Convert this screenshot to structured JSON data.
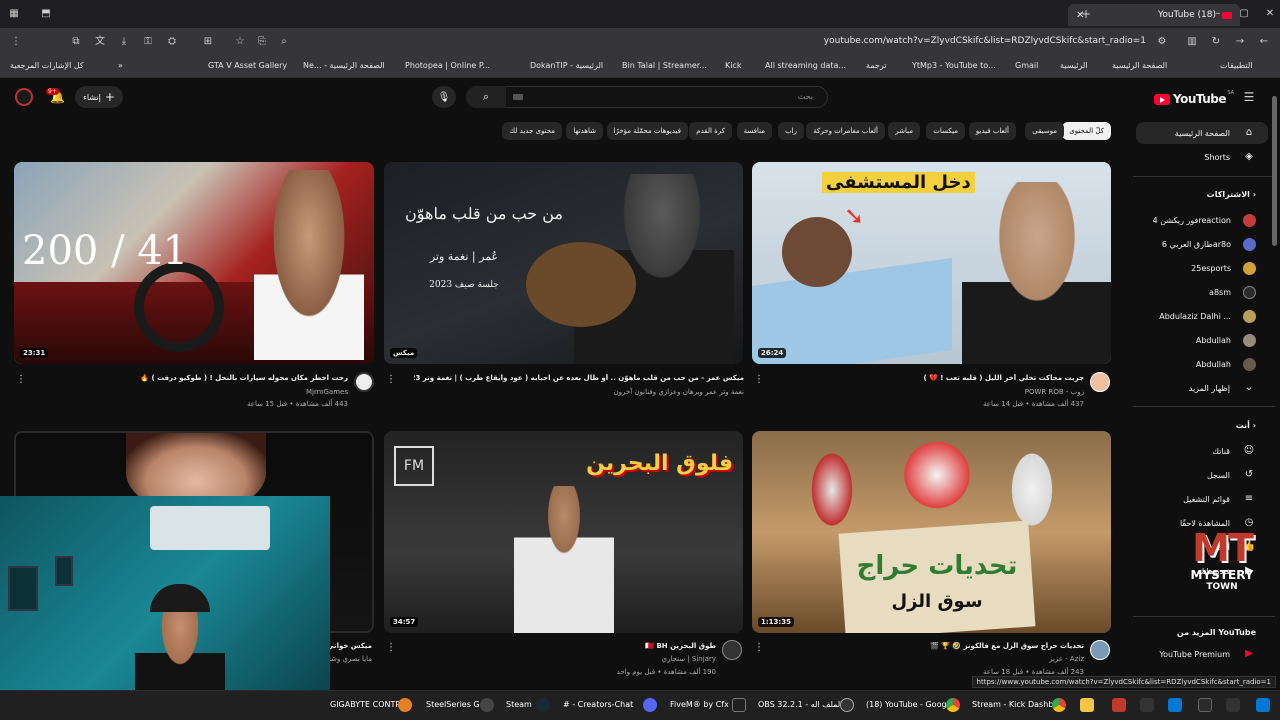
{
  "browser": {
    "tab_title": "(18) YouTube",
    "url": "youtube.com/watch?v=ZlyvdCSkifc&list=RDZlyvdCSkifc&start_radio=1",
    "bookmarks": [
      "كل الإشارات المرجعية",
      "GTA V Asset Gallery",
      "Ne... - الصفحة الرئيسية",
      "Photopea | Online P...",
      "DokanTIP - الرئيسية",
      "Bin Talal | Streamer...",
      "Kick",
      "All streaming data...",
      "ترجمة",
      "YtMp3 - YouTube to...",
      "Gmail",
      "الرئيسية",
      "الصفحة الرئيسية",
      "التطبيقات"
    ],
    "status_url": "https://www.youtube.com/watch?v=ZlyvdCSkifc&list=RDZlyvdCSkifc&start_radio=1"
  },
  "header": {
    "logo": "YouTube",
    "logo_cc": "SA",
    "search_placeholder": "بحث",
    "create_label": "إنشاء",
    "notif_count": "9+"
  },
  "chips": [
    "كلّ المحتوى",
    "موسيقى",
    "ألعاب فيديو",
    "ميكسات",
    "مباشر",
    "ألعاب مغامرات وحركة",
    "راب",
    "منافسة",
    "كرة القدم",
    "فيديوهات محمّلة مؤخرًا",
    "شاهدتها",
    "محتوى جديد لك"
  ],
  "sidebar": {
    "main": [
      {
        "label": "الصفحة الرئيسية",
        "icon": "home-icon"
      },
      {
        "label": "Shorts",
        "icon": "shorts-icon"
      }
    ],
    "subs_header": "الاشتراكات",
    "subs": [
      {
        "label": "فور ريكشن 4reaction",
        "color": "#c63b3b"
      },
      {
        "label": "طارق العربي 6ar8o",
        "color": "#5a6acd"
      },
      {
        "label": "25esports",
        "color": "#d1a23a"
      },
      {
        "label": "a8sm",
        "color": "#2c2c2c"
      },
      {
        "label": "Abdulaziz Dalhi ...",
        "color": "#b8a05a"
      },
      {
        "label": "Abdullah",
        "color": "#9a8a7a"
      },
      {
        "label": "Abdullah",
        "color": "#6a5a4a"
      }
    ],
    "show_more": "إظهار المزيد",
    "you_header": "أنت",
    "you": [
      {
        "label": "قناتك",
        "icon": "account-icon"
      },
      {
        "label": "السجل",
        "icon": "history-icon"
      },
      {
        "label": "قوائم التشغيل",
        "icon": "playlists-icon"
      },
      {
        "label": "المشاهدة لاحقًا",
        "icon": "watch-later-icon"
      },
      {
        "label": "أعجبني",
        "icon": "like-icon"
      },
      {
        "label": "فيديوهاتك",
        "icon": "your-videos-icon"
      }
    ],
    "more_header": "المزيد من YouTube",
    "premium": "YouTube Premium"
  },
  "videos": [
    {
      "title": "رحت اخطر مكان محوله سيارات بالنحل ! ( طوكيو درفت ) 🔥",
      "channel": "MjrmGames",
      "meta": "443 ألف مشاهدة • قبل 15 ساعة",
      "duration": "23:31",
      "overlay": "200 / 41"
    },
    {
      "title": "ميكس عمر - من حب من قلب ماهوّن .. أو طال بعده عن احبابه ( عود وايقاع طرب ) | نغمة وتر 2023",
      "channel": "نغمة وتر عمر وبرهان وعزازي وفنانون آخرون",
      "meta": "",
      "duration": "ميكس",
      "overlay_line1": "من حب من قلب ماهوّن",
      "overlay_line2": "عُمر | نغمة وتر",
      "overlay_line3": "جلسة صيف 2023"
    },
    {
      "title": "جربت محاكت تخلي أخر الليل ( قلبه تعب ! 💔 )",
      "channel": "زوب - POWR ROB",
      "meta": "437 ألف مشاهدة • قبل 14 ساعة",
      "duration": "26:24",
      "overlay": "دخل المستشفى"
    },
    {
      "title": "ميكس خواني ...",
      "channel": "مايا نصري وشاهين ...",
      "meta": "",
      "duration": ""
    },
    {
      "title": "طوق البحرين 🇧🇭 BH",
      "channel": "Sinjary | سنجاري",
      "meta": "190 ألف مشاهدة • قبل يوم واحد",
      "duration": "34:57",
      "overlay": "فلوق البحرين"
    },
    {
      "title": "تحديات حراج سوق الزل مع فالكونز 🤣 🏆 🎬",
      "channel": "Aziz - عزيز",
      "meta": "243 ألف مشاهدة • قبل 18 ساعة",
      "duration": "1:13:35",
      "overlay1": "تحديات حراج",
      "overlay2": "سوق الزل"
    }
  ],
  "watermark": {
    "line1": "MT",
    "line2": "MYSTERY",
    "line3": "TOWN"
  },
  "taskbar": [
    "GIGABYTE CONTROL",
    "SteelSeries G",
    "Steam",
    "# - Creators-Chat",
    "FiveM® by Cfx",
    "OBS 32.2.1 - الملف اله",
    "(18) YouTube - Goog",
    "Stream - Kick Dashb"
  ]
}
